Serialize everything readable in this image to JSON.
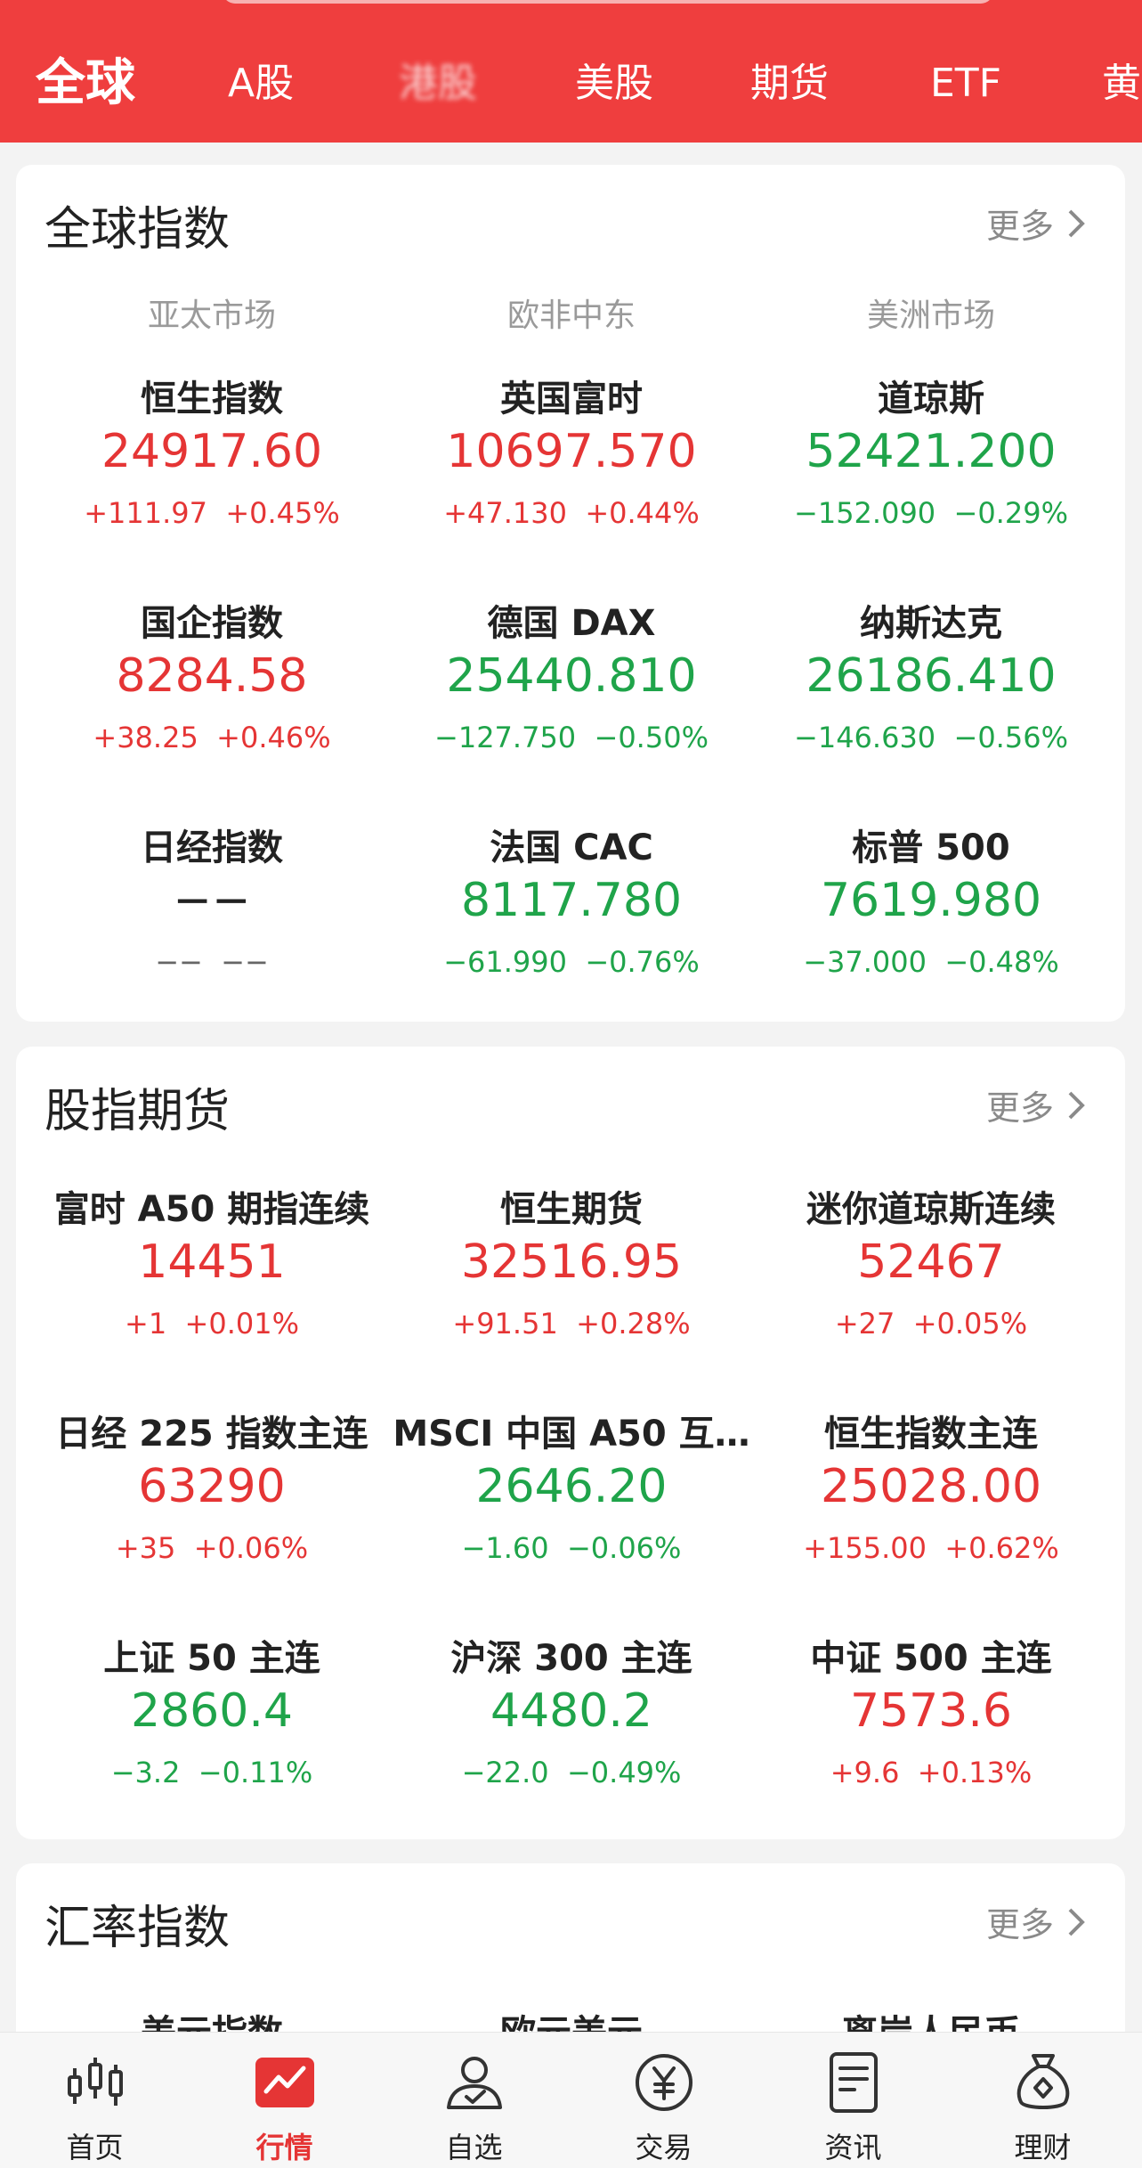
{
  "colors": {
    "brand": "#ef3e3e",
    "up": "#e53535",
    "down": "#1fa44a"
  },
  "tabs": [
    {
      "label": "全球",
      "active": true
    },
    {
      "label": "A股"
    },
    {
      "label": "港股",
      "blurred": true
    },
    {
      "label": "美股"
    },
    {
      "label": "期货"
    },
    {
      "label": "ETF"
    },
    {
      "label": "黄"
    }
  ],
  "global_index": {
    "title": "全球指数",
    "more": "更多",
    "regions": [
      "亚太市场",
      "欧非中东",
      "美洲市场"
    ],
    "items": [
      {
        "name": "恒生指数",
        "price": "24917.60",
        "change": "+111.97",
        "pct": "+0.45%",
        "dir": "up"
      },
      {
        "name": "英国富时",
        "price": "10697.570",
        "change": "+47.130",
        "pct": "+0.44%",
        "dir": "up"
      },
      {
        "name": "道琼斯",
        "price": "52421.200",
        "change": "−152.090",
        "pct": "−0.29%",
        "dir": "down"
      },
      {
        "name": "国企指数",
        "price": "8284.58",
        "change": "+38.25",
        "pct": "+0.46%",
        "dir": "up"
      },
      {
        "name": "德国 DAX",
        "price": "25440.810",
        "change": "−127.750",
        "pct": "−0.50%",
        "dir": "down"
      },
      {
        "name": "纳斯达克",
        "price": "26186.410",
        "change": "−146.630",
        "pct": "−0.56%",
        "dir": "down"
      },
      {
        "name": "日经指数",
        "price": "−−",
        "change": "−−",
        "pct": "−−",
        "dir": "flat"
      },
      {
        "name": "法国 CAC",
        "price": "8117.780",
        "change": "−61.990",
        "pct": "−0.76%",
        "dir": "down"
      },
      {
        "name": "标普 500",
        "price": "7619.980",
        "change": "−37.000",
        "pct": "−0.48%",
        "dir": "down"
      }
    ]
  },
  "futures": {
    "title": "股指期货",
    "more": "更多",
    "items": [
      {
        "name": "富时 A50 期指连续",
        "price": "14451",
        "change": "+1",
        "pct": "+0.01%",
        "dir": "up"
      },
      {
        "name": "恒生期货",
        "price": "32516.95",
        "change": "+91.51",
        "pct": "+0.28%",
        "dir": "up"
      },
      {
        "name": "迷你道琼斯连续",
        "price": "52467",
        "change": "+27",
        "pct": "+0.05%",
        "dir": "up"
      },
      {
        "name": "日经 225 指数主连",
        "price": "63290",
        "change": "+35",
        "pct": "+0.06%",
        "dir": "up"
      },
      {
        "name": "MSCI 中国 A50 互…",
        "price": "2646.20",
        "change": "−1.60",
        "pct": "−0.06%",
        "dir": "down"
      },
      {
        "name": "恒生指数主连",
        "price": "25028.00",
        "change": "+155.00",
        "pct": "+0.62%",
        "dir": "up"
      },
      {
        "name": "上证 50 主连",
        "price": "2860.4",
        "change": "−3.2",
        "pct": "−0.11%",
        "dir": "down"
      },
      {
        "name": "沪深 300 主连",
        "price": "4480.2",
        "change": "−22.0",
        "pct": "−0.49%",
        "dir": "down"
      },
      {
        "name": "中证 500 主连",
        "price": "7573.6",
        "change": "+9.6",
        "pct": "+0.13%",
        "dir": "up"
      }
    ]
  },
  "fx": {
    "title": "汇率指数",
    "more": "更多",
    "items": [
      {
        "name": "美元指数"
      },
      {
        "name": "欧元美元"
      },
      {
        "name": "离岸人民币"
      }
    ]
  },
  "nav": [
    {
      "label": "首页",
      "icon": "candlestick-icon"
    },
    {
      "label": "行情",
      "icon": "market-chart-icon",
      "active": true
    },
    {
      "label": "自选",
      "icon": "user-check-icon"
    },
    {
      "label": "交易",
      "icon": "yen-coin-icon"
    },
    {
      "label": "资讯",
      "icon": "news-document-icon"
    },
    {
      "label": "理财",
      "icon": "money-bag-icon"
    }
  ]
}
